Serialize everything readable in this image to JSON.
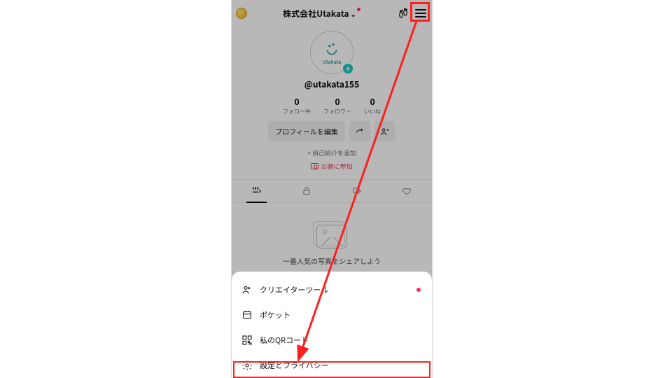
{
  "header": {
    "title": "株式会社Utakata",
    "coin_icon": "coin",
    "footprint_icon": "footprint",
    "menu_icon": "hamburger"
  },
  "profile": {
    "avatar_label": "Utakata",
    "username": "@utakata155",
    "stats": [
      {
        "count": "0",
        "label": "フォロー中"
      },
      {
        "count": "0",
        "label": "フォロワー"
      },
      {
        "count": "0",
        "label": "いいね"
      }
    ],
    "edit_button": "プロフィールを編集",
    "share_icon": "share",
    "add_friend_icon": "add-friend",
    "add_bio": "+ 自己紹介を追加",
    "topic_label": "お題に参加"
  },
  "tabs": {
    "grid": "grid",
    "lock": "lock",
    "repost": "repost",
    "like": "like"
  },
  "empty_feed": {
    "message": "一番人気の写真をシェアしよう"
  },
  "menu": {
    "items": [
      {
        "icon": "creator-tools",
        "label": "クリエイターツール",
        "dot": true
      },
      {
        "icon": "pocket",
        "label": "ポケット",
        "dot": false
      },
      {
        "icon": "qrcode",
        "label": "私のQRコード",
        "dot": false
      },
      {
        "icon": "settings",
        "label": "設定とプライバシー",
        "dot": false
      }
    ]
  },
  "annotations": {
    "hamburger_highlight": "red-box",
    "settings_highlight": "red-box",
    "arrow": "from-hamburger-to-settings"
  }
}
